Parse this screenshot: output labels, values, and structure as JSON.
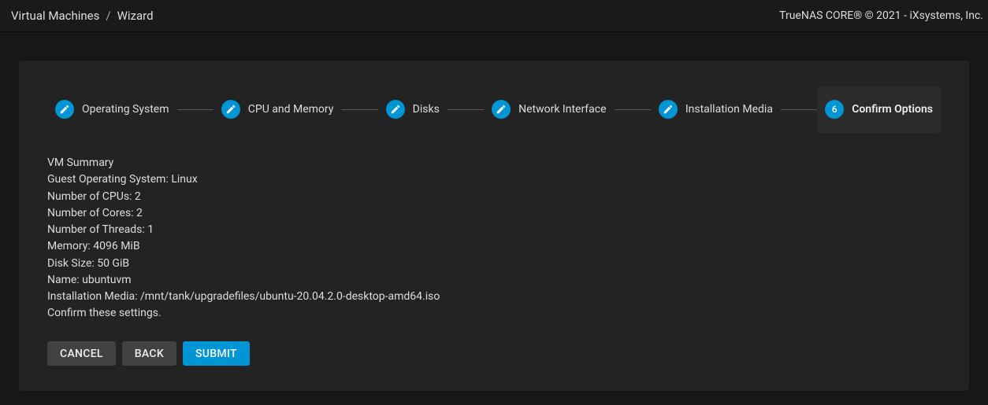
{
  "topbar": {
    "breadcrumb_root": "Virtual Machines",
    "breadcrumb_sep": "/",
    "breadcrumb_leaf": "Wizard",
    "copyright": "TrueNAS CORE® © 2021 - iXsystems, Inc."
  },
  "stepper": {
    "steps": [
      {
        "label": "Operating System",
        "completed": true
      },
      {
        "label": "CPU and Memory",
        "completed": true
      },
      {
        "label": "Disks",
        "completed": true
      },
      {
        "label": "Network Interface",
        "completed": true
      },
      {
        "label": "Installation Media",
        "completed": true
      },
      {
        "label": "Confirm Options",
        "number": "6",
        "active": true
      }
    ]
  },
  "summary": {
    "title": "VM Summary",
    "lines": {
      "guest_os": "Guest Operating System: Linux",
      "cpus": "Number of CPUs: 2",
      "cores": "Number of Cores: 2",
      "threads": "Number of Threads: 1",
      "memory": "Memory: 4096 MiB",
      "disk_size": "Disk Size: 50 GiB",
      "name": "Name: ubuntuvm",
      "install_media": "Installation Media: /mnt/tank/upgradefiles/ubuntu-20.04.2.0-desktop-amd64.iso",
      "confirm": "Confirm these settings."
    }
  },
  "buttons": {
    "cancel": "CANCEL",
    "back": "BACK",
    "submit": "SUBMIT"
  }
}
